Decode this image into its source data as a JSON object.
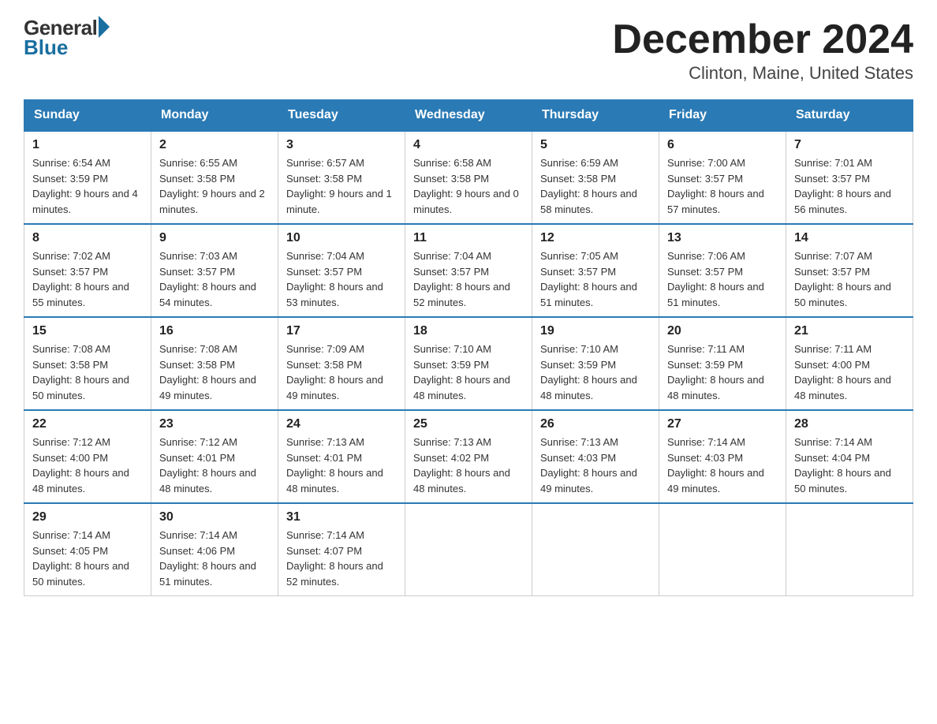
{
  "logo": {
    "general": "General",
    "blue": "Blue"
  },
  "title": "December 2024",
  "location": "Clinton, Maine, United States",
  "weekdays": [
    "Sunday",
    "Monday",
    "Tuesday",
    "Wednesday",
    "Thursday",
    "Friday",
    "Saturday"
  ],
  "weeks": [
    [
      {
        "day": "1",
        "sunrise": "6:54 AM",
        "sunset": "3:59 PM",
        "daylight": "9 hours and 4 minutes."
      },
      {
        "day": "2",
        "sunrise": "6:55 AM",
        "sunset": "3:58 PM",
        "daylight": "9 hours and 2 minutes."
      },
      {
        "day": "3",
        "sunrise": "6:57 AM",
        "sunset": "3:58 PM",
        "daylight": "9 hours and 1 minute."
      },
      {
        "day": "4",
        "sunrise": "6:58 AM",
        "sunset": "3:58 PM",
        "daylight": "9 hours and 0 minutes."
      },
      {
        "day": "5",
        "sunrise": "6:59 AM",
        "sunset": "3:58 PM",
        "daylight": "8 hours and 58 minutes."
      },
      {
        "day": "6",
        "sunrise": "7:00 AM",
        "sunset": "3:57 PM",
        "daylight": "8 hours and 57 minutes."
      },
      {
        "day": "7",
        "sunrise": "7:01 AM",
        "sunset": "3:57 PM",
        "daylight": "8 hours and 56 minutes."
      }
    ],
    [
      {
        "day": "8",
        "sunrise": "7:02 AM",
        "sunset": "3:57 PM",
        "daylight": "8 hours and 55 minutes."
      },
      {
        "day": "9",
        "sunrise": "7:03 AM",
        "sunset": "3:57 PM",
        "daylight": "8 hours and 54 minutes."
      },
      {
        "day": "10",
        "sunrise": "7:04 AM",
        "sunset": "3:57 PM",
        "daylight": "8 hours and 53 minutes."
      },
      {
        "day": "11",
        "sunrise": "7:04 AM",
        "sunset": "3:57 PM",
        "daylight": "8 hours and 52 minutes."
      },
      {
        "day": "12",
        "sunrise": "7:05 AM",
        "sunset": "3:57 PM",
        "daylight": "8 hours and 51 minutes."
      },
      {
        "day": "13",
        "sunrise": "7:06 AM",
        "sunset": "3:57 PM",
        "daylight": "8 hours and 51 minutes."
      },
      {
        "day": "14",
        "sunrise": "7:07 AM",
        "sunset": "3:57 PM",
        "daylight": "8 hours and 50 minutes."
      }
    ],
    [
      {
        "day": "15",
        "sunrise": "7:08 AM",
        "sunset": "3:58 PM",
        "daylight": "8 hours and 50 minutes."
      },
      {
        "day": "16",
        "sunrise": "7:08 AM",
        "sunset": "3:58 PM",
        "daylight": "8 hours and 49 minutes."
      },
      {
        "day": "17",
        "sunrise": "7:09 AM",
        "sunset": "3:58 PM",
        "daylight": "8 hours and 49 minutes."
      },
      {
        "day": "18",
        "sunrise": "7:10 AM",
        "sunset": "3:59 PM",
        "daylight": "8 hours and 48 minutes."
      },
      {
        "day": "19",
        "sunrise": "7:10 AM",
        "sunset": "3:59 PM",
        "daylight": "8 hours and 48 minutes."
      },
      {
        "day": "20",
        "sunrise": "7:11 AM",
        "sunset": "3:59 PM",
        "daylight": "8 hours and 48 minutes."
      },
      {
        "day": "21",
        "sunrise": "7:11 AM",
        "sunset": "4:00 PM",
        "daylight": "8 hours and 48 minutes."
      }
    ],
    [
      {
        "day": "22",
        "sunrise": "7:12 AM",
        "sunset": "4:00 PM",
        "daylight": "8 hours and 48 minutes."
      },
      {
        "day": "23",
        "sunrise": "7:12 AM",
        "sunset": "4:01 PM",
        "daylight": "8 hours and 48 minutes."
      },
      {
        "day": "24",
        "sunrise": "7:13 AM",
        "sunset": "4:01 PM",
        "daylight": "8 hours and 48 minutes."
      },
      {
        "day": "25",
        "sunrise": "7:13 AM",
        "sunset": "4:02 PM",
        "daylight": "8 hours and 48 minutes."
      },
      {
        "day": "26",
        "sunrise": "7:13 AM",
        "sunset": "4:03 PM",
        "daylight": "8 hours and 49 minutes."
      },
      {
        "day": "27",
        "sunrise": "7:14 AM",
        "sunset": "4:03 PM",
        "daylight": "8 hours and 49 minutes."
      },
      {
        "day": "28",
        "sunrise": "7:14 AM",
        "sunset": "4:04 PM",
        "daylight": "8 hours and 50 minutes."
      }
    ],
    [
      {
        "day": "29",
        "sunrise": "7:14 AM",
        "sunset": "4:05 PM",
        "daylight": "8 hours and 50 minutes."
      },
      {
        "day": "30",
        "sunrise": "7:14 AM",
        "sunset": "4:06 PM",
        "daylight": "8 hours and 51 minutes."
      },
      {
        "day": "31",
        "sunrise": "7:14 AM",
        "sunset": "4:07 PM",
        "daylight": "8 hours and 52 minutes."
      },
      null,
      null,
      null,
      null
    ]
  ]
}
